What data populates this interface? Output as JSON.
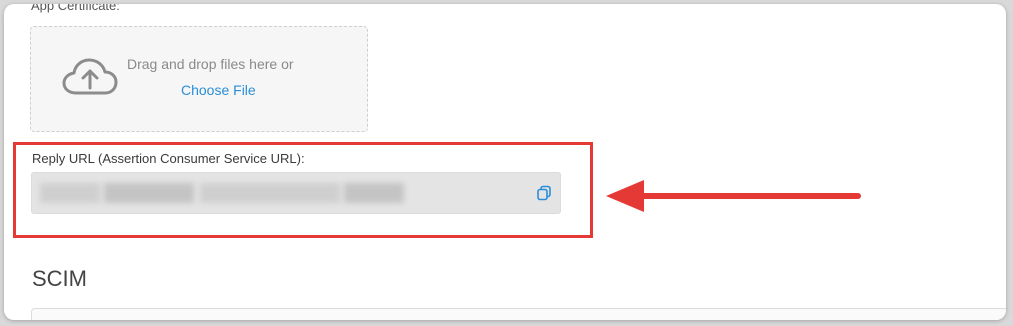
{
  "certificate": {
    "label": "App Certificate:",
    "drop_text": "Drag and drop files here or",
    "choose_file_label": "Choose File",
    "icon": "cloud-upload-icon"
  },
  "reply_url": {
    "label": "Reply URL (Assertion Consumer Service URL):",
    "value": "",
    "copy_icon": "copy-icon"
  },
  "annotation": {
    "highlight_color": "#e53935",
    "arrow_color": "#e53935"
  },
  "scim": {
    "heading": "SCIM"
  },
  "colors": {
    "link": "#2a8ed8",
    "field_background": "#e4e4e4"
  }
}
